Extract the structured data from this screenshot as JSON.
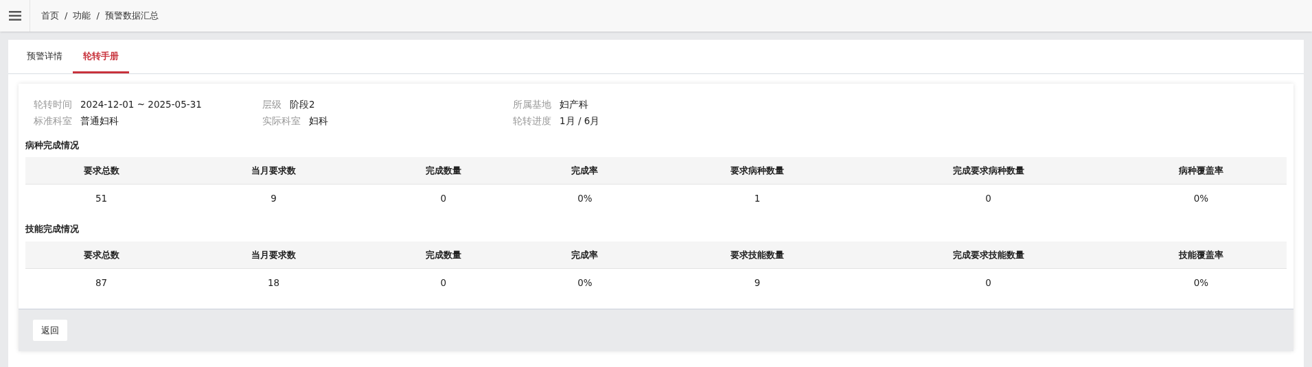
{
  "breadcrumb": [
    "首页",
    "功能",
    "预警数据汇总"
  ],
  "breadcrumb_separator": "/",
  "tabs": [
    {
      "label": "预警详情",
      "selected": false
    },
    {
      "label": "轮转手册",
      "selected": true
    }
  ],
  "info": [
    {
      "label": "轮转时间",
      "value": "2024-12-01 ~ 2025-05-31"
    },
    {
      "label": "层级",
      "value": "阶段2"
    },
    {
      "label": "所属基地",
      "value": "妇产科"
    },
    {
      "label": "标准科室",
      "value": "普通妇科"
    },
    {
      "label": "实际科室",
      "value": "妇科"
    },
    {
      "label": "轮转进度",
      "value": "1月 / 6月"
    }
  ],
  "sections": [
    {
      "title": "病种完成情况",
      "columns": [
        "要求总数",
        "当月要求数",
        "完成数量",
        "完成率",
        "要求病种数量",
        "完成要求病种数量",
        "病种覆盖率"
      ],
      "rows": [
        [
          "51",
          "9",
          "0",
          "0%",
          "1",
          "0",
          "0%"
        ]
      ]
    },
    {
      "title": "技能完成情况",
      "columns": [
        "要求总数",
        "当月要求数",
        "完成数量",
        "完成率",
        "要求技能数量",
        "完成要求技能数量",
        "技能覆盖率"
      ],
      "rows": [
        [
          "87",
          "18",
          "0",
          "0%",
          "9",
          "0",
          "0%"
        ]
      ]
    }
  ],
  "footer": {
    "button": "返回"
  }
}
